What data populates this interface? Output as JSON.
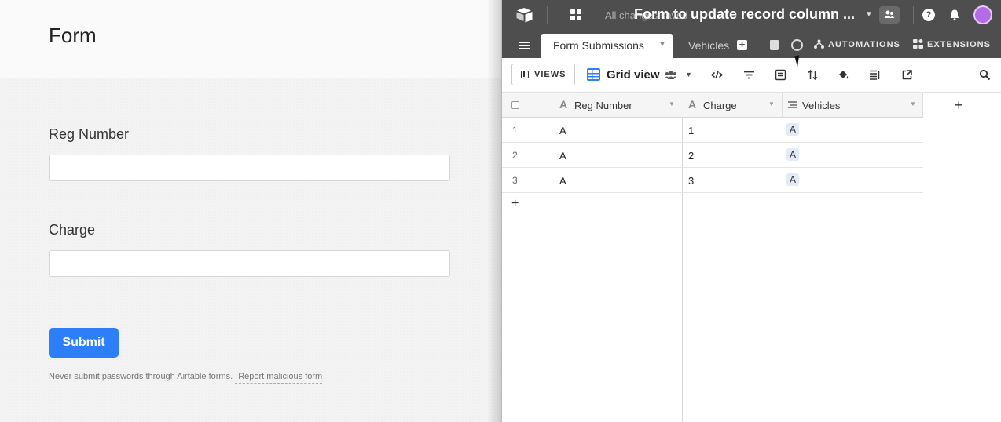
{
  "form": {
    "title": "Form",
    "fields": [
      {
        "label": "Reg Number",
        "value": ""
      },
      {
        "label": "Charge",
        "value": ""
      }
    ],
    "submit_label": "Submit",
    "footer_note": "Never submit passwords through Airtable forms.",
    "report_link": "Report malicious form"
  },
  "app": {
    "changes_text": "All changes saved",
    "base_title": "Form to update record column ...",
    "tabs": [
      {
        "label": "Form Submissions",
        "active": true
      },
      {
        "label": "Vehicles",
        "active": false
      }
    ],
    "automations_label": "AUTOMATIONS",
    "extensions_label": "EXTENSIONS",
    "views_label": "VIEWS",
    "view_name": "Grid view",
    "help_glyph": "?",
    "add_glyph": "+",
    "accent_color": "#2d7ff9",
    "topbar_color": "#4e4e4e",
    "avatar_color": "#b36be6"
  },
  "grid": {
    "columns": [
      {
        "name": "Reg Number",
        "type_icon": "text-type-icon"
      },
      {
        "name": "Charge",
        "type_icon": "text-type-icon"
      },
      {
        "name": "Vehicles",
        "type_icon": "linked-record-icon"
      }
    ],
    "rows": [
      {
        "num": "1",
        "reg": "A",
        "charge": "1",
        "vehicle": "A"
      },
      {
        "num": "2",
        "reg": "A",
        "charge": "2",
        "vehicle": "A"
      },
      {
        "num": "3",
        "reg": "A",
        "charge": "3",
        "vehicle": "A"
      }
    ]
  }
}
